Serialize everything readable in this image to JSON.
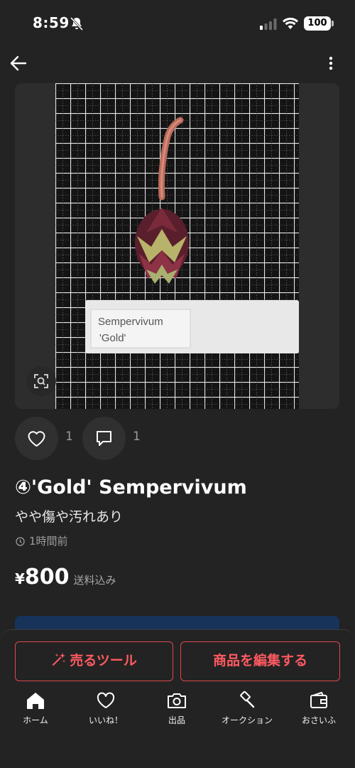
{
  "status_bar": {
    "time": "8:59",
    "battery": "100"
  },
  "product": {
    "title": "④'Gold' Sempervivum",
    "condition": "やや傷や汚れあり",
    "posted": "1時間前",
    "price_symbol": "¥",
    "price": "800",
    "shipping": "送料込み",
    "likes": "1",
    "comments": "1",
    "photo_label_line1": "Sempervivum",
    "photo_label_line2": "'Gold'"
  },
  "actions": {
    "sell_tools": "売るツール",
    "edit_item": "商品を編集する"
  },
  "nav": {
    "items": [
      {
        "label": "ホーム",
        "icon": "home-icon"
      },
      {
        "label": "いいね！",
        "icon": "heart-icon"
      },
      {
        "label": "出品",
        "icon": "camera-icon"
      },
      {
        "label": "オークション",
        "icon": "gavel-icon"
      },
      {
        "label": "おさいふ",
        "icon": "wallet-icon"
      }
    ]
  },
  "colors": {
    "accent": "#ff5a61",
    "background": "#232323",
    "promo": "#17335a"
  }
}
